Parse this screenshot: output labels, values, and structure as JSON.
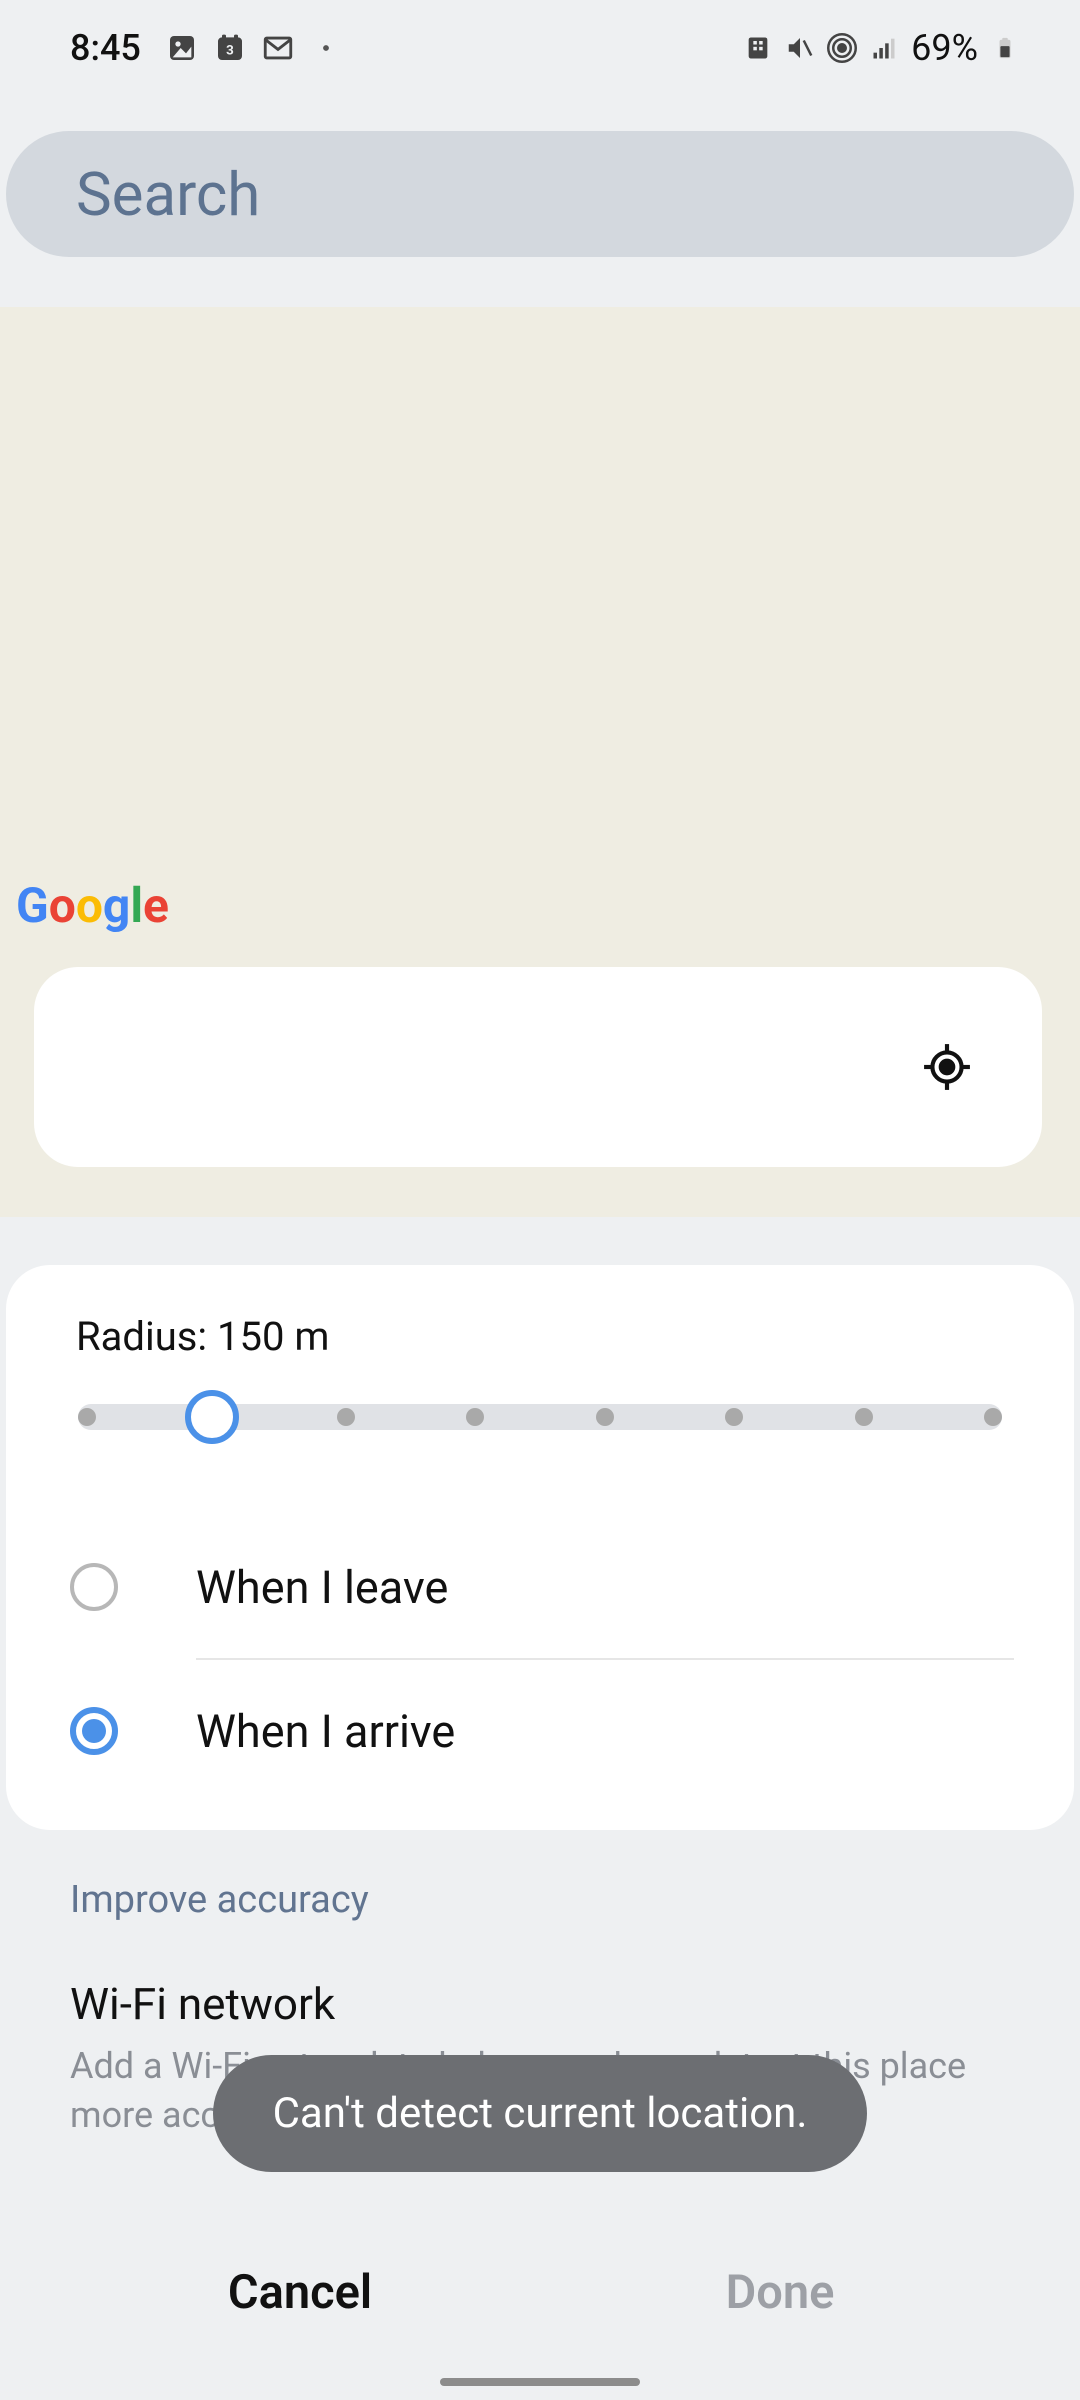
{
  "status": {
    "time": "8:45",
    "battery_text": "69%"
  },
  "search": {
    "placeholder": "Search"
  },
  "map": {
    "logo": "Google"
  },
  "radius": {
    "label": "Radius: 150 m",
    "value": 150,
    "unit": "m",
    "thumb_position_pct": 12.5
  },
  "trigger_options": [
    {
      "label": "When I leave",
      "selected": false
    },
    {
      "label": "When I arrive",
      "selected": true
    }
  ],
  "improve": {
    "heading": "Improve accuracy",
    "wifi_title": "Wi-Fi network",
    "wifi_sub": "Add a Wi-Fi network to help your phone detect this place more accurately."
  },
  "buttons": {
    "cancel": "Cancel",
    "done": "Done"
  },
  "toast": {
    "message": "Can't detect current location."
  }
}
